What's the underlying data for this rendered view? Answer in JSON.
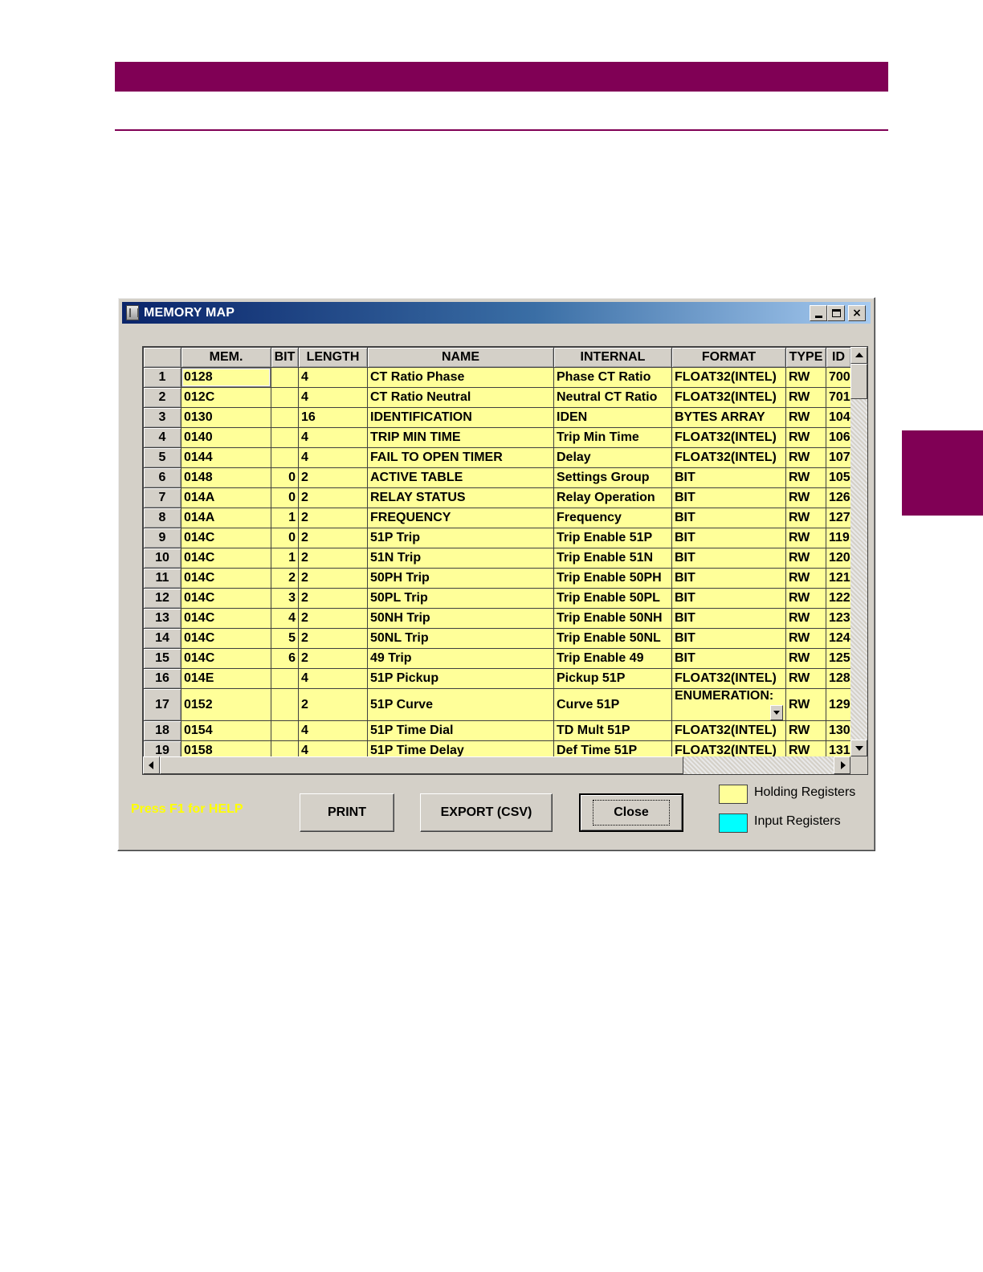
{
  "window": {
    "title": "MEMORY MAP",
    "close_glyph": "×"
  },
  "table": {
    "headers": [
      "",
      "MEM.",
      "BIT",
      "LENGTH",
      "NAME",
      "INTERNAL",
      "FORMAT",
      "TYPE",
      "ID"
    ],
    "rows": [
      {
        "num": "1",
        "mem": "0128",
        "bit": "",
        "length": "4",
        "name": "CT Ratio Phase",
        "internal": "Phase CT Ratio",
        "format": "FLOAT32(INTEL)",
        "type": "RW",
        "id": "700"
      },
      {
        "num": "2",
        "mem": "012C",
        "bit": "",
        "length": "4",
        "name": "CT Ratio Neutral",
        "internal": "Neutral CT Ratio",
        "format": "FLOAT32(INTEL)",
        "type": "RW",
        "id": "701"
      },
      {
        "num": "3",
        "mem": "0130",
        "bit": "",
        "length": "16",
        "name": "IDENTIFICATION",
        "internal": "IDEN",
        "format": "BYTES ARRAY",
        "type": "RW",
        "id": "104"
      },
      {
        "num": "4",
        "mem": "0140",
        "bit": "",
        "length": "4",
        "name": "TRIP MIN TIME",
        "internal": "Trip Min Time",
        "format": "FLOAT32(INTEL)",
        "type": "RW",
        "id": "106"
      },
      {
        "num": "5",
        "mem": "0144",
        "bit": "",
        "length": "4",
        "name": "FAIL TO OPEN TIMER",
        "internal": "Delay",
        "format": "FLOAT32(INTEL)",
        "type": "RW",
        "id": "107"
      },
      {
        "num": "6",
        "mem": "0148",
        "bit": "0",
        "length": "2",
        "name": "ACTIVE TABLE",
        "internal": "Settings Group",
        "format": "BIT",
        "type": "RW",
        "id": "105"
      },
      {
        "num": "7",
        "mem": "014A",
        "bit": "0",
        "length": "2",
        "name": "RELAY STATUS",
        "internal": "Relay Operation",
        "format": "BIT",
        "type": "RW",
        "id": "126"
      },
      {
        "num": "8",
        "mem": "014A",
        "bit": "1",
        "length": "2",
        "name": "FREQUENCY",
        "internal": "Frequency",
        "format": "BIT",
        "type": "RW",
        "id": "127"
      },
      {
        "num": "9",
        "mem": "014C",
        "bit": "0",
        "length": "2",
        "name": "51P Trip",
        "internal": "Trip Enable 51P",
        "format": "BIT",
        "type": "RW",
        "id": "119"
      },
      {
        "num": "10",
        "mem": "014C",
        "bit": "1",
        "length": "2",
        "name": "51N Trip",
        "internal": "Trip Enable 51N",
        "format": "BIT",
        "type": "RW",
        "id": "120"
      },
      {
        "num": "11",
        "mem": "014C",
        "bit": "2",
        "length": "2",
        "name": "50PH Trip",
        "internal": "Trip Enable 50PH",
        "format": "BIT",
        "type": "RW",
        "id": "121"
      },
      {
        "num": "12",
        "mem": "014C",
        "bit": "3",
        "length": "2",
        "name": "50PL Trip",
        "internal": "Trip Enable 50PL",
        "format": "BIT",
        "type": "RW",
        "id": "122"
      },
      {
        "num": "13",
        "mem": "014C",
        "bit": "4",
        "length": "2",
        "name": "50NH Trip",
        "internal": "Trip Enable 50NH",
        "format": "BIT",
        "type": "RW",
        "id": "123"
      },
      {
        "num": "14",
        "mem": "014C",
        "bit": "5",
        "length": "2",
        "name": "50NL Trip",
        "internal": "Trip Enable 50NL",
        "format": "BIT",
        "type": "RW",
        "id": "124"
      },
      {
        "num": "15",
        "mem": "014C",
        "bit": "6",
        "length": "2",
        "name": "49 Trip",
        "internal": "Trip Enable 49",
        "format": "BIT",
        "type": "RW",
        "id": "125"
      },
      {
        "num": "16",
        "mem": "014E",
        "bit": "",
        "length": "4",
        "name": "51P Pickup",
        "internal": "Pickup 51P",
        "format": "FLOAT32(INTEL)",
        "type": "RW",
        "id": "128"
      },
      {
        "num": "17",
        "mem": "0152",
        "bit": "",
        "length": "2",
        "name": "51P Curve",
        "internal": "Curve 51P",
        "format": "ENUMERATION:",
        "type": "RW",
        "id": "129"
      },
      {
        "num": "18",
        "mem": "0154",
        "bit": "",
        "length": "4",
        "name": "51P Time Dial",
        "internal": "TD Mult 51P",
        "format": "FLOAT32(INTEL)",
        "type": "RW",
        "id": "130"
      },
      {
        "num": "19",
        "mem": "0158",
        "bit": "",
        "length": "4",
        "name": "51P Time Delay",
        "internal": "Def Time 51P",
        "format": "FLOAT32(INTEL)",
        "type": "RW",
        "id": "131"
      }
    ]
  },
  "footer": {
    "help_text": "Press F1 for HELP",
    "print_label": "PRINT",
    "export_label": "EXPORT (CSV)",
    "close_label": "Close"
  },
  "legend": {
    "holding_label": "Holding Registers",
    "input_label": "Input Registers",
    "holding_color": "#ffff99",
    "input_color": "#00ffff"
  },
  "colors": {
    "accent": "#800055"
  }
}
